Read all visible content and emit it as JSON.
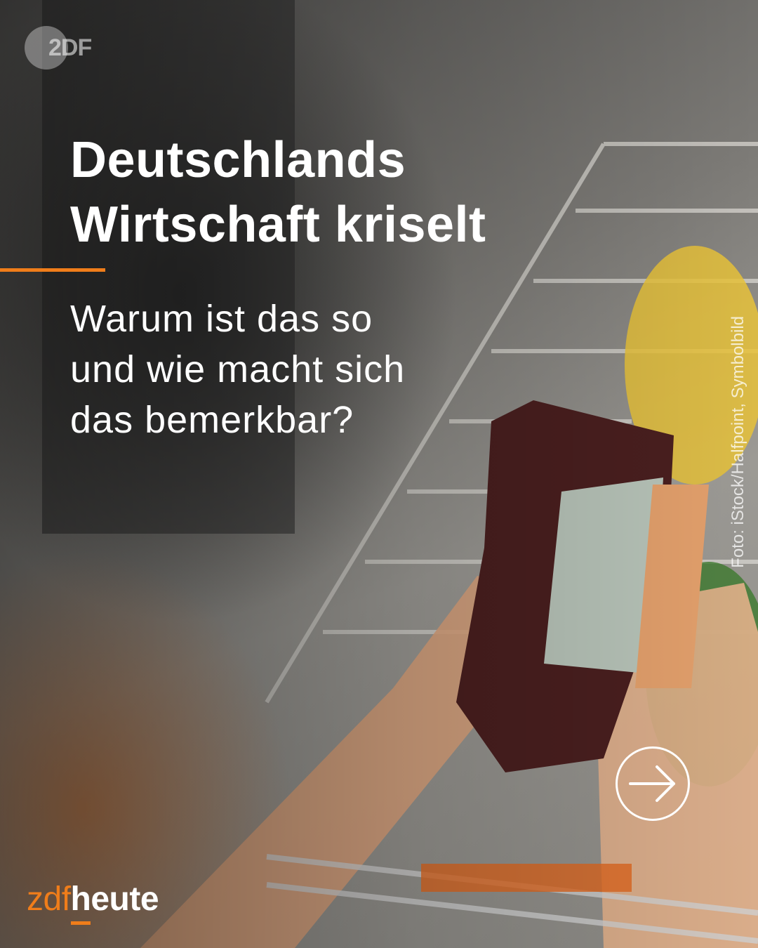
{
  "post": {
    "headline_line1": "Deutschlands",
    "headline_line2": "Wirtschaft kriselt",
    "subline_line1": "Warum ist das so",
    "subline_line2": "und wie macht sich",
    "subline_line3": "das bemerkbar?",
    "photo_credit": "Foto: iStock/Halfpoint, Symbolbild"
  },
  "logo": {
    "broadcaster": "2DF"
  },
  "brand": {
    "part1": "zdf",
    "part2": "heute"
  },
  "icons": {
    "next": "arrow-right-circle-icon"
  },
  "colors": {
    "accent": "#f07d1a",
    "text": "#ffffff"
  }
}
